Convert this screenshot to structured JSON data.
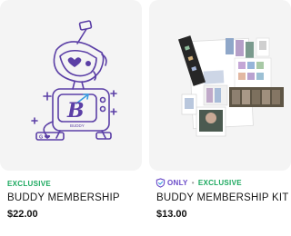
{
  "products": [
    {
      "badge": "EXCLUSIVE",
      "title": "BUDDY MEMBERSHIP",
      "price": "$22.00",
      "image": {
        "icon": "buddy-robot-tv-illustration",
        "screen_text": "BUDDY",
        "base_text": "G"
      }
    },
    {
      "badge_only": "ONLY",
      "badge_separator": "•",
      "badge": "EXCLUSIVE",
      "title": "BUDDY MEMBERSHIP KIT",
      "price": "$13.00",
      "image": {
        "icon": "membership-kit-photo"
      }
    }
  ],
  "colors": {
    "exclusive_green": "#1aa85e",
    "only_purple": "#6a4bc8",
    "illustration_purple": "#5b3fa6",
    "thumb_bg": "#f4f4f4"
  }
}
